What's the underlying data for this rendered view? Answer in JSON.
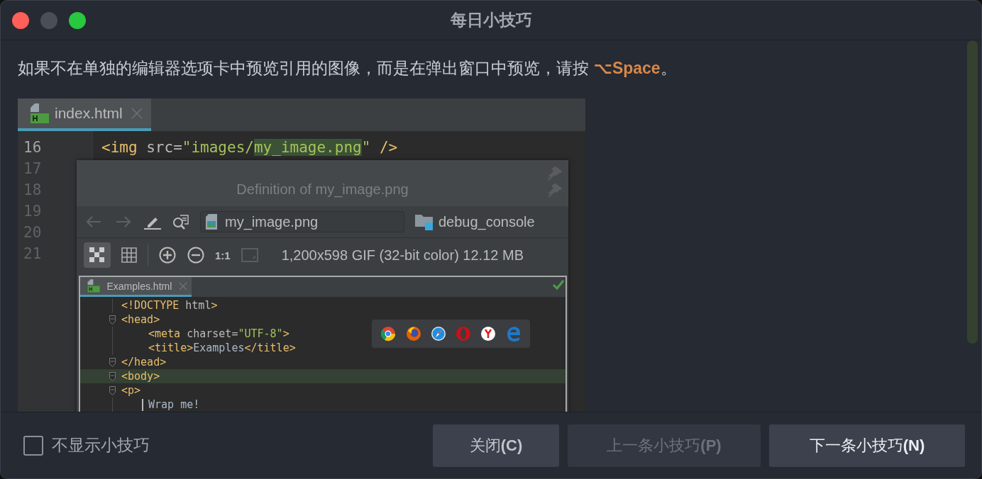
{
  "window": {
    "title": "每日小技巧"
  },
  "tip": {
    "text": "如果不在单独的编辑器选项卡中预览引用的图像，而是在弹出窗口中预览，请按 ",
    "shortcut": "⌥Space",
    "text_end": "。"
  },
  "screenshot": {
    "tabs": [
      {
        "label": "index.html",
        "selected": true
      }
    ],
    "line_numbers": [
      {
        "text": "16",
        "current": true
      },
      {
        "text": "17",
        "current": false
      },
      {
        "text": "18",
        "current": false
      },
      {
        "text": "19",
        "current": false
      },
      {
        "text": "20",
        "current": false
      },
      {
        "text": "21",
        "current": false
      }
    ],
    "code": [
      {
        "tokens": [
          {
            "text": "<img",
            "kind": "tag"
          },
          {
            "text": " src=",
            "kind": "attr"
          },
          {
            "text": "\"images/",
            "kind": "string"
          },
          {
            "text": "my_image.png",
            "kind": "string",
            "highlighted": true
          },
          {
            "text": "\"",
            "kind": "string"
          },
          {
            "text": " />",
            "kind": "tag"
          }
        ]
      }
    ],
    "popup": {
      "title": "Definition of my_image.png",
      "file": "my_image.png",
      "folder": "debug_console",
      "zoom_label": "1:1",
      "info": "1,200x598 GIF (32-bit color) 12.12 MB",
      "preview": {
        "tabs": [
          {
            "label": "Examples.html",
            "selected": true
          }
        ],
        "lines": [
          {
            "fold": false,
            "current": false,
            "tokens": [
              {
                "text": "<!DOCTYPE",
                "kind": "tag"
              },
              {
                "text": " html",
                "kind": "attr"
              },
              {
                "text": ">",
                "kind": "tag"
              }
            ]
          },
          {
            "fold": true,
            "current": false,
            "tokens": [
              {
                "text": "<head>",
                "kind": "tag"
              }
            ],
            "children": [
              {
                "fold": false,
                "current": false,
                "tokens": [
                  {
                    "text": "<meta",
                    "kind": "tag"
                  },
                  {
                    "text": " charset=",
                    "kind": "attr"
                  },
                  {
                    "text": "\"UTF-8\"",
                    "kind": "string"
                  },
                  {
                    "text": ">",
                    "kind": "tag"
                  }
                ]
              },
              {
                "fold": false,
                "current": false,
                "tokens": [
                  {
                    "text": "<title>",
                    "kind": "tag"
                  },
                  {
                    "text": "Examples",
                    "kind": "text"
                  },
                  {
                    "text": "</title>",
                    "kind": "tag"
                  }
                ]
              }
            ]
          },
          {
            "fold": true,
            "current": false,
            "tokens": [
              {
                "text": "</head>",
                "kind": "tag"
              }
            ]
          },
          {
            "fold": true,
            "current": true,
            "tokens": [
              {
                "text": "<body>",
                "kind": "tag"
              }
            ]
          },
          {
            "fold": true,
            "current": false,
            "tokens": [
              {
                "text": "<p>",
                "kind": "tag"
              }
            ],
            "children": [
              {
                "fold": false,
                "current": false,
                "caret": true,
                "tokens": [
                  {
                    "text": "Wrap me!",
                    "kind": "text"
                  }
                ]
              }
            ]
          }
        ]
      }
    }
  },
  "footer": {
    "checkbox": {
      "label": "不显示小技巧",
      "checked": false
    },
    "buttons": [
      {
        "label": "关闭**(C)**",
        "disabled": false,
        "default": false
      },
      {
        "label": "上一条小技巧**(P)**",
        "disabled": true,
        "default": false
      },
      {
        "label": "下一条小技巧**(N)**",
        "disabled": false,
        "default": true
      }
    ]
  }
}
